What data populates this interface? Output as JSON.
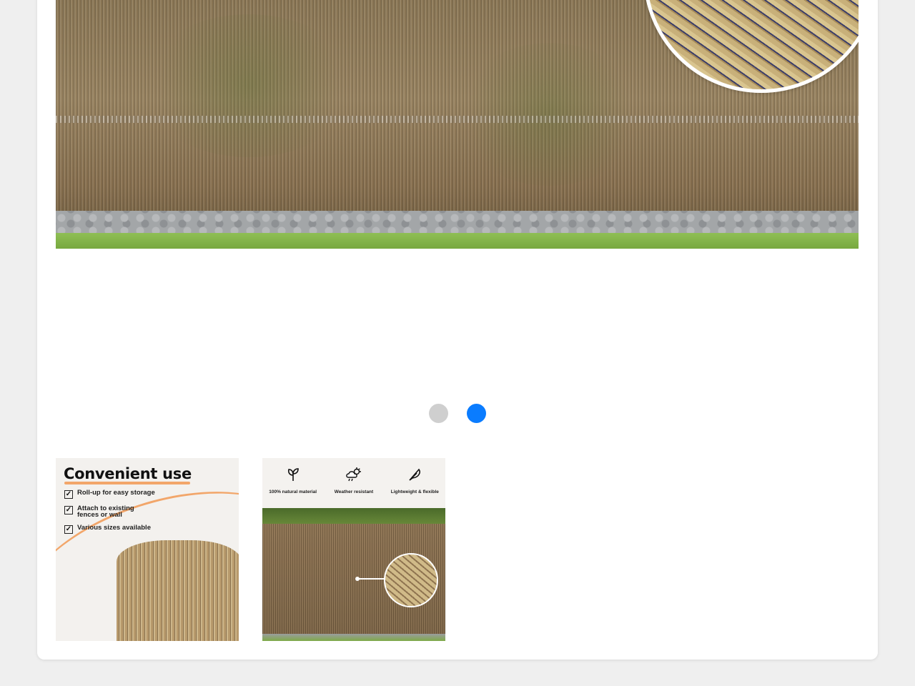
{
  "gallery": {
    "main_image_alt": "Bamboo reed fence roll with close-up detail",
    "dots": [
      {
        "state": "inactive",
        "color": "#cfcfcf"
      },
      {
        "state": "active",
        "color": "#0a7cff"
      }
    ]
  },
  "thumbnails": {
    "thumb1": {
      "title": "Convenient use",
      "accent_color": "#f2a66a",
      "features": [
        "Roll-up for easy storage",
        "Attach to existing fences or wall",
        "Various sizes available"
      ]
    },
    "thumb2": {
      "features": [
        {
          "icon": "leaf-icon",
          "label": "100% natural material"
        },
        {
          "icon": "weather-icon",
          "label": "Weather resistant"
        },
        {
          "icon": "feather-icon",
          "label": "Lightweight & flexible"
        }
      ]
    }
  }
}
